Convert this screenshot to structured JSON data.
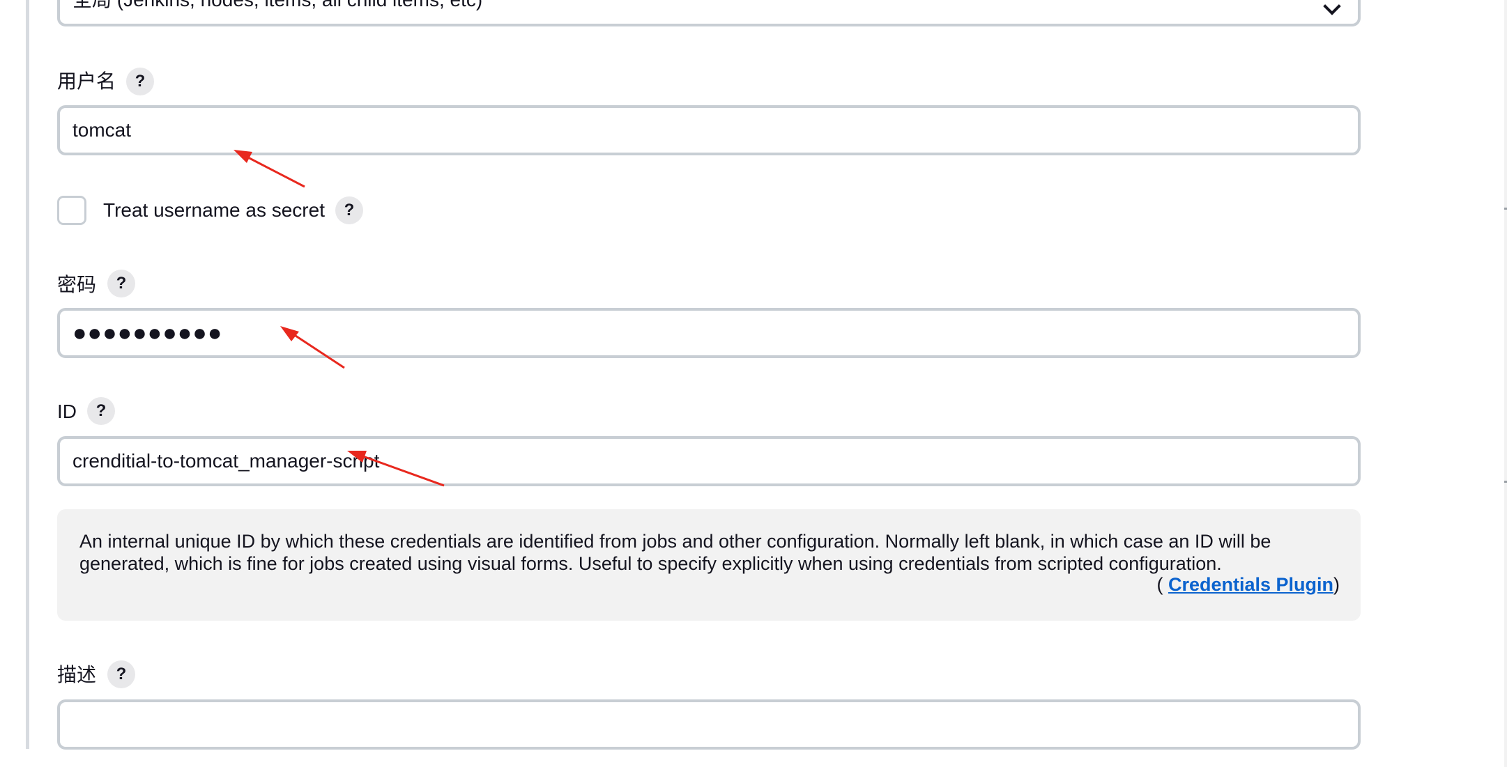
{
  "scope_select": {
    "value": "全局 (Jenkins, nodes, items, all child items, etc)"
  },
  "username": {
    "label": "用户名",
    "value": "tomcat"
  },
  "treat_username_secret": {
    "label": "Treat username as secret",
    "checked": false
  },
  "password": {
    "label": "密码",
    "value": "●●●●●●●●●●"
  },
  "id_field": {
    "label": "ID",
    "value": "crenditial-to-tomcat_manager-script"
  },
  "id_help": {
    "text": "An internal unique ID by which these credentials are identified from jobs and other configuration. Normally left blank, in which case an ID will be generated, which is fine for jobs created using visual forms. Useful to specify explicitly when using credentials from scripted configuration.",
    "plugin_open": "( ",
    "plugin_link": "Credentials Plugin",
    "plugin_close": ")"
  },
  "description": {
    "label": "描述",
    "value": ""
  },
  "help_glyph": "?",
  "colors": {
    "link": "#0b63ce",
    "annotation_arrow": "#e8281e",
    "field_border": "#c8ced4",
    "help_panel_bg": "#f2f2f2"
  }
}
